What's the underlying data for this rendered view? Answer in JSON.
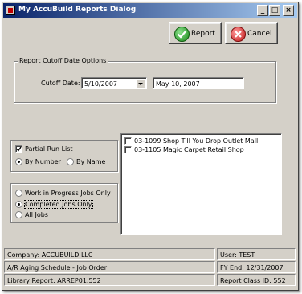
{
  "window": {
    "title": "My AccuBuild Reports Dialog",
    "controls": [
      "_",
      "□",
      "×"
    ]
  },
  "toolbar": {
    "report_label": "Report",
    "cancel_label": "Cancel"
  },
  "cutoff": {
    "group_title": "Report Cutoff Date Options",
    "label": "Cutoff Date:",
    "date_value": "5/10/2007",
    "date_text": "May 10, 2007"
  },
  "run_options": {
    "partial_run_label": "Partial Run List",
    "partial_run_checked": true,
    "by_number_label": "By Number",
    "by_name_label": "By Name",
    "sort_selected": "By Number"
  },
  "job_filter": {
    "wip_label": "Work in Progress Jobs Only",
    "completed_label": "Completed Jobs Only",
    "all_label": "All Jobs",
    "selected": "Completed Jobs Only"
  },
  "jobs": [
    {
      "label": "03-1099 Shop Till You Drop Outlet Mall",
      "checked": false
    },
    {
      "label": "03-1105 Magic Carpet Retail Shop",
      "checked": false
    }
  ],
  "status": {
    "company": "Company: ACCUBUILD LLC",
    "user": "User: TEST",
    "schedule": "A/R Aging Schedule - Job Order",
    "fy_end": "FY End: 12/31/2007",
    "library_report": "Library Report: ARREP01.552",
    "report_class": "Report Class ID: 552"
  },
  "colors": {
    "titlebar_start": "#0a246a",
    "titlebar_end": "#a6caf0",
    "face": "#d4d0c8"
  }
}
